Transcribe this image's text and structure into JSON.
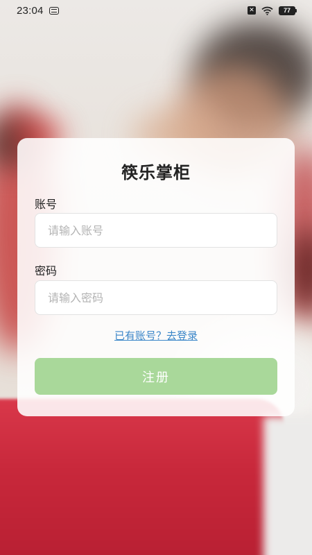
{
  "status_bar": {
    "time": "23:04",
    "battery": "77"
  },
  "form": {
    "title": "筷乐掌柜",
    "account_label": "账号",
    "account_placeholder": "请输入账号",
    "password_label": "密码",
    "password_placeholder": "请输入密码",
    "login_link": "已有账号？去登录",
    "register_button": "注册"
  },
  "colors": {
    "button": "#a9d89a",
    "link": "#3a86c8",
    "table_cloth": "#c8283b"
  }
}
